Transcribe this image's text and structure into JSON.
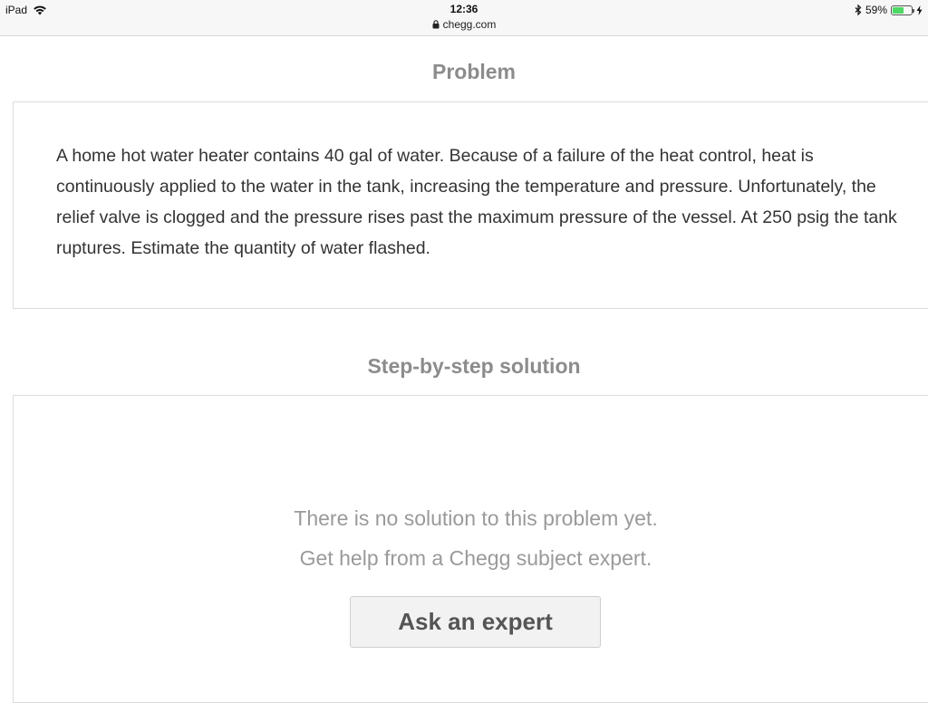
{
  "status_bar": {
    "device": "iPad",
    "time": "12:36",
    "url": "chegg.com",
    "battery_percent_text": "59%",
    "battery_level": 0.59,
    "icons": [
      "wifi-icon",
      "lock-icon",
      "bluetooth-icon",
      "battery-icon",
      "charging-icon"
    ]
  },
  "problem": {
    "title": "Problem",
    "text": "A home hot water heater contains 40 gal of water. Because of a failure of the heat control, heat is continuously applied to the water in the tank, increasing the temperature and pressure. Unfortunately, the relief valve is clogged and the pressure rises past the maximum pressure of the vessel. At 250 psig the tank ruptures. Estimate the quantity of water flashed."
  },
  "solution": {
    "title": "Step-by-step solution",
    "message_line1": "There is no solution to this problem yet.",
    "message_line2": "Get help from a Chegg subject expert.",
    "button_label": "Ask an expert"
  },
  "colors": {
    "heading": "#8c8c8c",
    "body_text": "#333333",
    "muted_text": "#9a9a9a",
    "battery": "#4cd964"
  }
}
